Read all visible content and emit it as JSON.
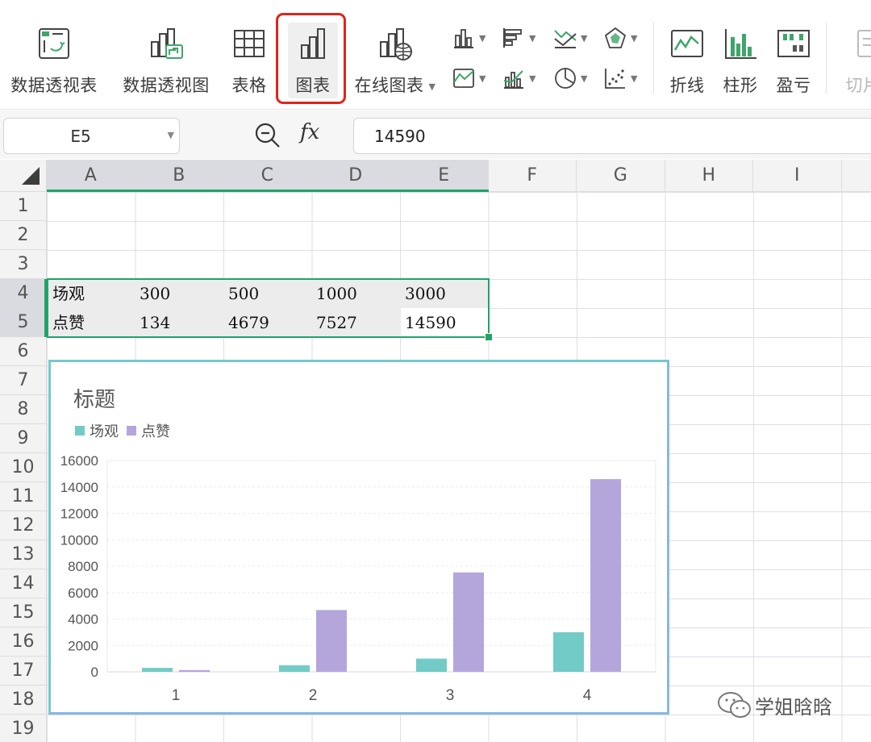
{
  "ribbon": {
    "pivot_table": "数据透视表",
    "pivot_chart": "数据透视图",
    "table": "表格",
    "chart": "图表",
    "online_chart": "在线图表",
    "sparkline_line": "折线",
    "sparkline_column": "柱形",
    "sparkline_winloss": "盈亏",
    "slicer": "切片"
  },
  "formula_bar": {
    "cell_ref": "E5",
    "fx": "fx",
    "formula": "14590"
  },
  "columns": [
    "A",
    "B",
    "C",
    "D",
    "E",
    "F",
    "G",
    "H",
    "I"
  ],
  "rows": [
    "1",
    "2",
    "3",
    "4",
    "5",
    "6",
    "7",
    "8",
    "9",
    "10",
    "11",
    "12",
    "13",
    "14",
    "15",
    "16",
    "17",
    "18",
    "19"
  ],
  "sheet": {
    "r4": [
      "场观",
      "300",
      "500",
      "1000",
      "3000"
    ],
    "r5": [
      "点赞",
      "134",
      "4679",
      "7527",
      "14590"
    ]
  },
  "colors": {
    "accent_green": "#20a36b",
    "highlight_red": "#e3221c",
    "series_1": "#72cbc6",
    "series_2": "#b4a6db"
  },
  "chart_data": {
    "type": "bar",
    "title": "标题",
    "categories": [
      "1",
      "2",
      "3",
      "4"
    ],
    "series": [
      {
        "name": "场观",
        "values": [
          300,
          500,
          1000,
          3000
        ]
      },
      {
        "name": "点赞",
        "values": [
          134,
          4679,
          7527,
          14590
        ]
      }
    ],
    "ylim": [
      0,
      16000
    ],
    "yticks": [
      "0",
      "2000",
      "4000",
      "6000",
      "8000",
      "10000",
      "12000",
      "14000",
      "16000"
    ],
    "legend": "top-left",
    "grid": true
  },
  "watermark": {
    "text": "学姐晗晗",
    "icon": "wechat-icon"
  }
}
